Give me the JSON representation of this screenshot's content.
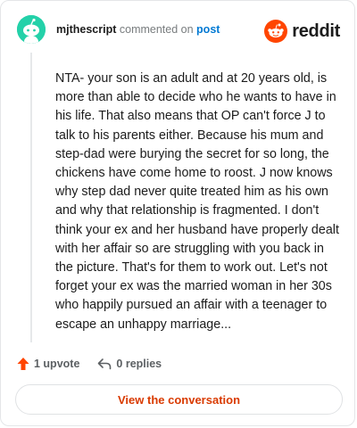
{
  "comment": {
    "author": "mjthescript",
    "action_text": "commented on",
    "post_link": "post",
    "body": "NTA- your son is an adult and at 20 years old, is more than able to decide who he wants to have in his life. That also means that OP can't force J to talk to his parents either. Because his mum and step-dad were burying the secret for so long, the chickens have come home to roost. J now knows why step dad never quite treated him as his own and why that relationship is fragmented. I don't think your ex and her husband have properly dealt with her affair so are struggling with you back in the picture. That's for them to work out. Let's not forget your ex was the married woman in her 30s who happily pursued an affair with a teenager to escape an unhappy marriage..."
  },
  "brand": {
    "name": "reddit",
    "icon": "reddit-snoo-icon",
    "color": "#ff4500"
  },
  "avatar": {
    "icon": "snoo-avatar-icon",
    "color": "#24d1a9"
  },
  "actions": {
    "upvote_label": "1 upvote",
    "upvote_icon": "upvote-arrow-icon",
    "replies_label": "0 replies",
    "reply_icon": "reply-arrow-icon"
  },
  "cta": {
    "label": "View the conversation",
    "color": "#d93a00"
  }
}
